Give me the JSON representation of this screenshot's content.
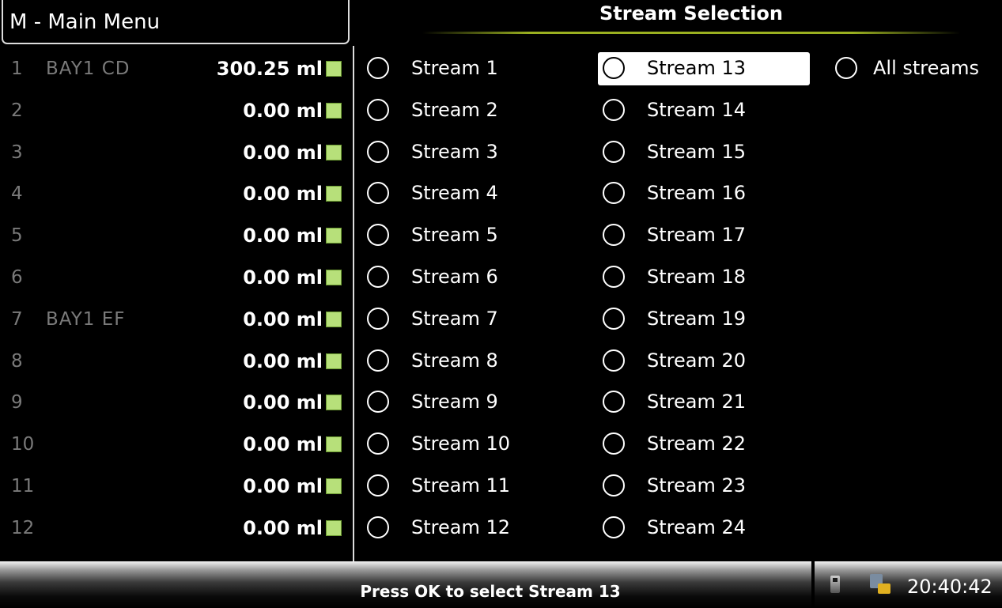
{
  "menu_title": "M - Main Menu",
  "stream_title": "Stream Selection",
  "bays": [
    {
      "num": "1",
      "name": "BAY1 CD",
      "value": "300.25 ml"
    },
    {
      "num": "2",
      "name": "",
      "value": "0.00 ml"
    },
    {
      "num": "3",
      "name": "",
      "value": "0.00 ml"
    },
    {
      "num": "4",
      "name": "",
      "value": "0.00 ml"
    },
    {
      "num": "5",
      "name": "",
      "value": "0.00 ml"
    },
    {
      "num": "6",
      "name": "",
      "value": "0.00 ml"
    },
    {
      "num": "7",
      "name": "BAY1 EF",
      "value": "0.00 ml"
    },
    {
      "num": "8",
      "name": "",
      "value": "0.00 ml"
    },
    {
      "num": "9",
      "name": "",
      "value": "0.00 ml"
    },
    {
      "num": "10",
      "name": "",
      "value": "0.00 ml"
    },
    {
      "num": "11",
      "name": "",
      "value": "0.00 ml"
    },
    {
      "num": "12",
      "name": "",
      "value": "0.00 ml"
    }
  ],
  "streams_col1": [
    "Stream 1",
    "Stream 2",
    "Stream 3",
    "Stream 4",
    "Stream 5",
    "Stream 6",
    "Stream 7",
    "Stream 8",
    "Stream 9",
    "Stream 10",
    "Stream 11",
    "Stream 12"
  ],
  "streams_col2": [
    "Stream 13",
    "Stream 14",
    "Stream 15",
    "Stream 16",
    "Stream 17",
    "Stream 18",
    "Stream 19",
    "Stream 20",
    "Stream 21",
    "Stream 22",
    "Stream 23",
    "Stream 24"
  ],
  "all_streams": "All streams",
  "selected_stream": "Stream 13",
  "status_text": "Press OK to select Stream 13",
  "clock": "20:40:42",
  "colors": {
    "indicator": "#b7e07a",
    "accent_line": "#9ab020",
    "dim_text": "#7a7a7a"
  }
}
